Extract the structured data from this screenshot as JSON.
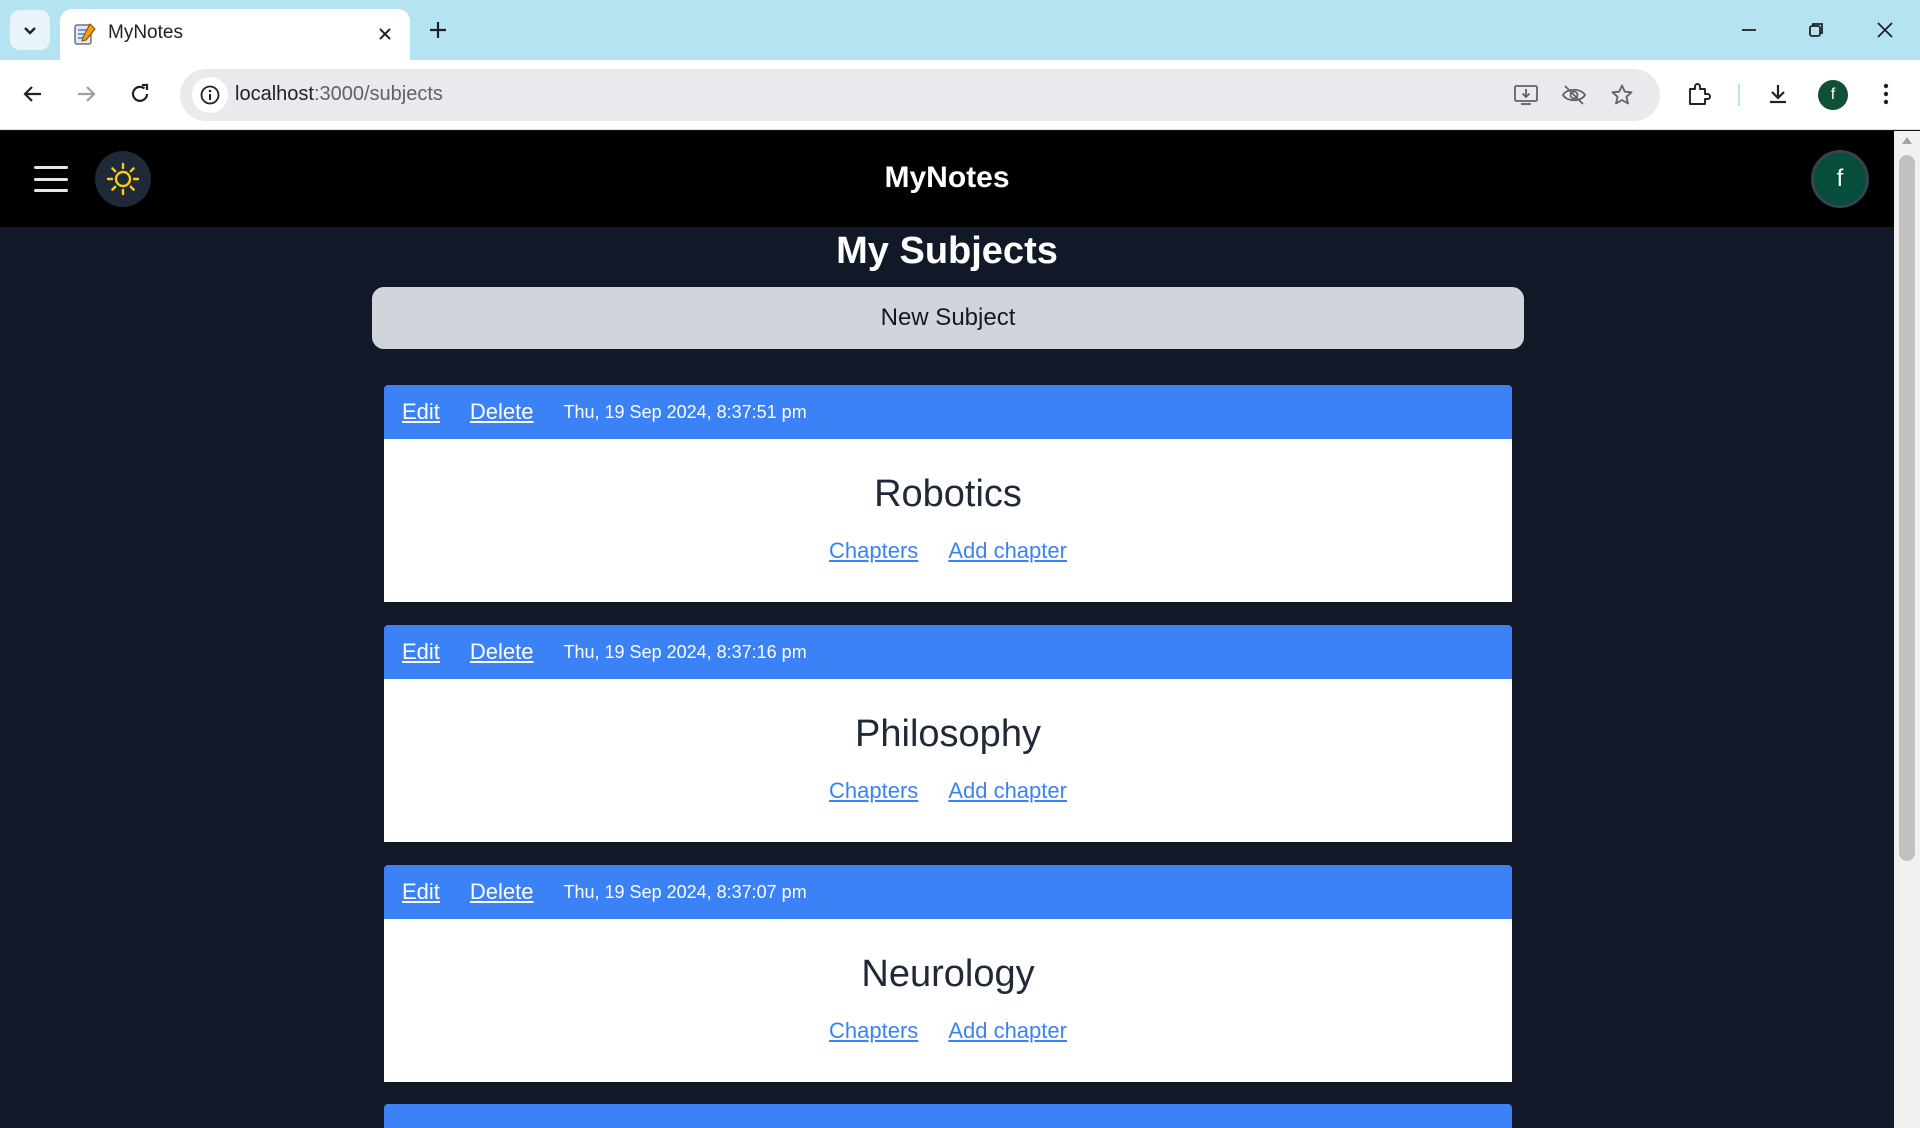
{
  "browser": {
    "tab_title": "MyNotes",
    "url_host": "localhost",
    "url_path": ":3000/subjects",
    "profile_initial": "f"
  },
  "app": {
    "title": "MyNotes",
    "avatar_initial": "f"
  },
  "page": {
    "heading": "My Subjects",
    "new_subject_label": "New Subject"
  },
  "subjects": [
    {
      "edit": "Edit",
      "delete": "Delete",
      "timestamp": "Thu, 19 Sep 2024, 8:37:51 pm",
      "name": "Robotics",
      "chapters": "Chapters",
      "add_chapter": "Add chapter"
    },
    {
      "edit": "Edit",
      "delete": "Delete",
      "timestamp": "Thu, 19 Sep 2024, 8:37:16 pm",
      "name": "Philosophy",
      "chapters": "Chapters",
      "add_chapter": "Add chapter"
    },
    {
      "edit": "Edit",
      "delete": "Delete",
      "timestamp": "Thu, 19 Sep 2024, 8:37:07 pm",
      "name": "Neurology",
      "chapters": "Chapters",
      "add_chapter": "Add chapter"
    }
  ],
  "colors": {
    "tabstrip": "#b5e3f2",
    "nav_bg": "#000000",
    "page_bg": "#111827",
    "card_header": "#3b82f6",
    "button_bg": "#d1d5db",
    "sun": "#facc15"
  },
  "icons": [
    "tab-search-icon",
    "favicon-icon",
    "close-icon",
    "plus-icon",
    "minimize-icon",
    "restore-icon",
    "back-icon",
    "forward-icon",
    "reload-icon",
    "info-icon",
    "install-icon",
    "eye-off-icon",
    "star-icon",
    "extensions-icon",
    "download-icon",
    "more-icon",
    "menu-icon",
    "sun-icon"
  ]
}
